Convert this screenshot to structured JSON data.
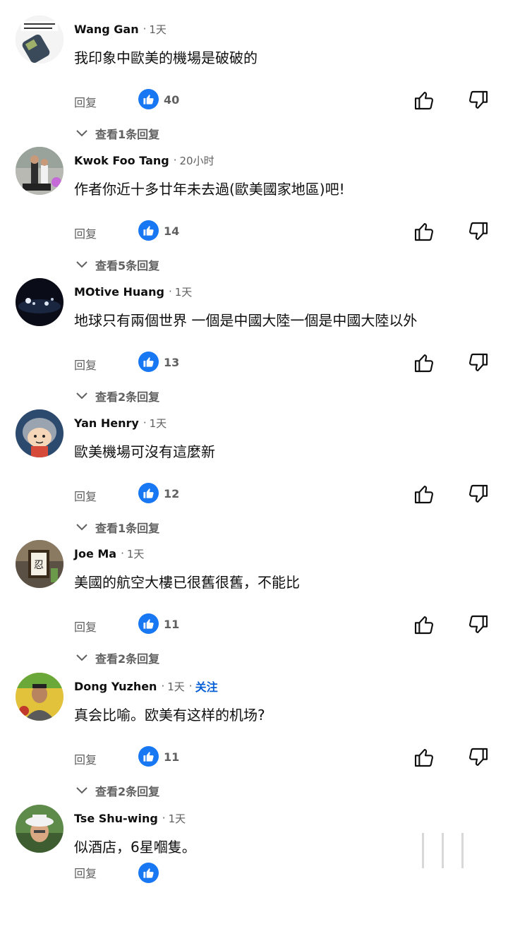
{
  "comments": [
    {
      "author": "Wang Gan",
      "time": "1天",
      "text": "我印象中歐美的機場是破破的",
      "reply_label": "回复",
      "likes": "40",
      "view_replies": "查看1条回复"
    },
    {
      "author": "Kwok Foo Tang",
      "time": "20小时",
      "text": "作者你近十多廿年未去過(歐美國家地區)吧!",
      "reply_label": "回复",
      "likes": "14",
      "view_replies": "查看5条回复"
    },
    {
      "author": "MOtive Huang",
      "time": "1天",
      "text": "地球只有兩個世界 一個是中國大陸一個是中國大陸以外",
      "reply_label": "回复",
      "likes": "13",
      "view_replies": "查看2条回复"
    },
    {
      "author": "Yan Henry",
      "time": "1天",
      "text": "歐美機場可沒有這麼新",
      "reply_label": "回复",
      "likes": "12",
      "view_replies": "查看1条回复"
    },
    {
      "author": "Joe Ma",
      "time": "1天",
      "text": "美國的航空大樓已很舊很舊，不能比",
      "reply_label": "回复",
      "likes": "11",
      "view_replies": "查看2条回复"
    },
    {
      "author": "Dong Yuzhen",
      "time": "1天",
      "follow": "关注",
      "text": "真会比喻。欧美有这样的机场?",
      "reply_label": "回复",
      "likes": "11",
      "view_replies": "查看2条回复"
    },
    {
      "author": "Tse Shu-wing",
      "time": "1天",
      "text": "似酒店，6星嗰隻。",
      "reply_label": "回复",
      "likes": "",
      "view_replies": ""
    }
  ],
  "colors": {
    "like_badge": "#1877f2",
    "follow": "#065fd4",
    "secondary_text": "#606060"
  }
}
